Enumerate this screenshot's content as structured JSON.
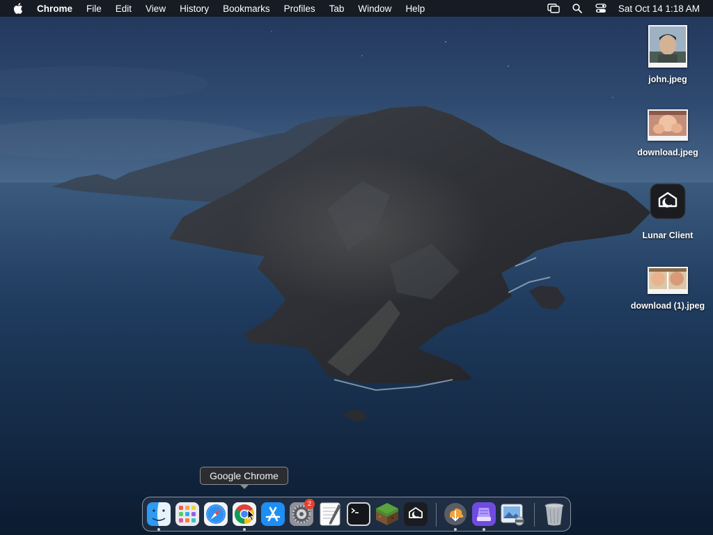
{
  "menubar": {
    "apple_icon": "apple-logo-icon",
    "app_name": "Chrome",
    "items": [
      "File",
      "Edit",
      "View",
      "History",
      "Bookmarks",
      "Profiles",
      "Tab",
      "Window",
      "Help"
    ],
    "status_icons": [
      "screen-mirroring-icon",
      "spotlight-search-icon",
      "control-center-icon"
    ],
    "clock": "Sat Oct 14  1:18 AM"
  },
  "desktop": {
    "icons": [
      {
        "label": "john.jpeg",
        "icon": "portrait-photo-thumbnail"
      },
      {
        "label": "download.jpeg",
        "icon": "photo-thumbnail"
      },
      {
        "label": "Lunar Client",
        "icon": "lunar-client-app-icon"
      },
      {
        "label": "download (1).jpeg",
        "icon": "photo-thumbnail"
      }
    ]
  },
  "tooltip": {
    "text": "Google Chrome"
  },
  "dock": {
    "apps": [
      {
        "name": "Finder",
        "icon": "finder-icon",
        "running": true
      },
      {
        "name": "Launchpad",
        "icon": "launchpad-icon",
        "running": false
      },
      {
        "name": "Safari",
        "icon": "safari-icon",
        "running": false
      },
      {
        "name": "Google Chrome",
        "icon": "chrome-icon",
        "running": true
      },
      {
        "name": "App Store",
        "icon": "app-store-icon",
        "running": false
      },
      {
        "name": "System Settings",
        "icon": "system-settings-icon",
        "running": false,
        "badge": "2"
      },
      {
        "name": "TextEdit",
        "icon": "textedit-icon",
        "running": false
      },
      {
        "name": "Terminal",
        "icon": "terminal-icon",
        "running": false
      },
      {
        "name": "Minecraft",
        "icon": "minecraft-icon",
        "running": false
      },
      {
        "name": "Lunar Client",
        "icon": "lunar-client-icon",
        "running": false
      },
      {
        "name": "Downloads",
        "icon": "downloads-stack-icon",
        "running": true
      },
      {
        "name": "Installer",
        "icon": "installer-icon",
        "running": true
      },
      {
        "name": "Preview",
        "icon": "preview-icon",
        "running": false
      },
      {
        "name": "Trash",
        "icon": "trash-icon",
        "running": false
      }
    ],
    "badge_text": "2"
  },
  "colors": {
    "menubar_bg": "#161a22",
    "ocean_dark": "#0e2036",
    "dock_border": "#e6ebf5",
    "badge": "#e8412f"
  }
}
